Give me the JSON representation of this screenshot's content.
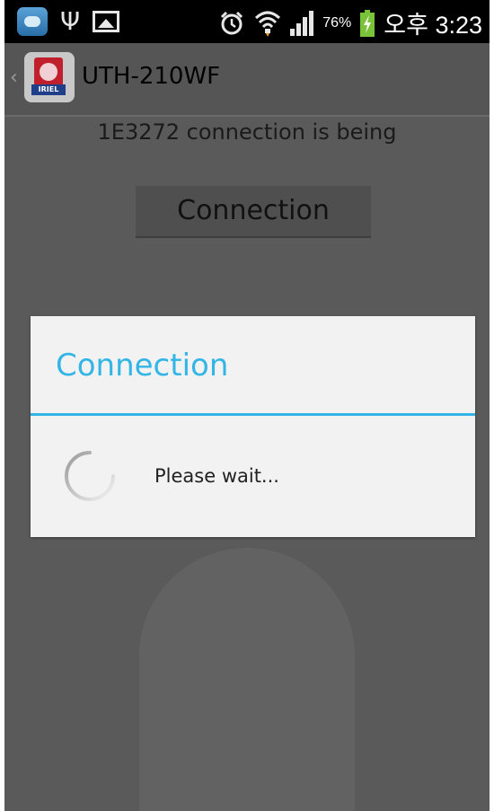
{
  "status_bar": {
    "battery_percent": "76%",
    "time": "오후 3:23",
    "icons": [
      "cloud-app-icon",
      "usb-icon",
      "image-icon",
      "alarm-icon",
      "wifi-icon",
      "signal-icon",
      "battery-charging-icon"
    ]
  },
  "action_bar": {
    "title": "UTH-210WF",
    "logo_text": "IRIEL"
  },
  "content": {
    "status_line": "1E3272 connection is being",
    "connection_button_label": "Connection"
  },
  "dialog": {
    "title": "Connection",
    "message": "Please wait...",
    "accent_color": "#33b5e5"
  }
}
